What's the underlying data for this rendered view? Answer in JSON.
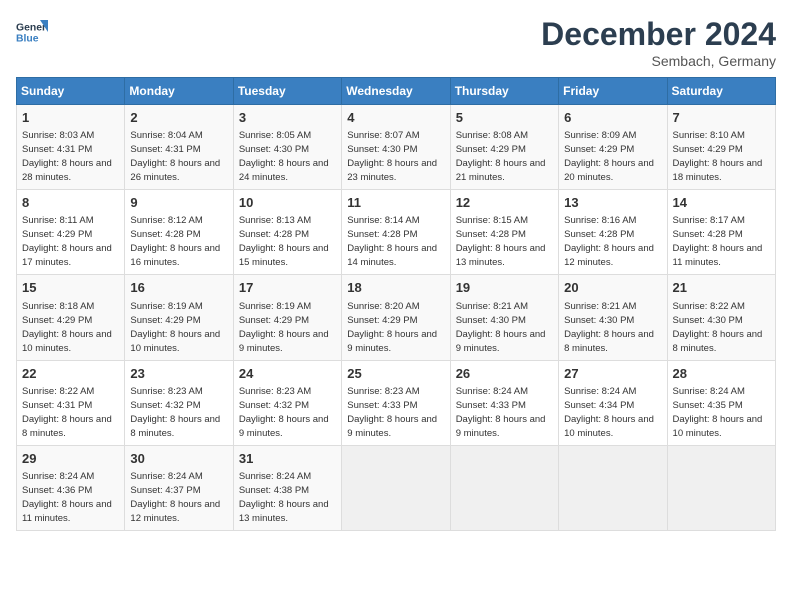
{
  "app": {
    "name": "GeneralBlue",
    "logo_icon": "flag-icon"
  },
  "title": "December 2024",
  "location": "Sembach, Germany",
  "days_of_week": [
    "Sunday",
    "Monday",
    "Tuesday",
    "Wednesday",
    "Thursday",
    "Friday",
    "Saturday"
  ],
  "weeks": [
    [
      {
        "day": "1",
        "sunrise": "8:03 AM",
        "sunset": "4:31 PM",
        "daylight": "8 hours and 28 minutes."
      },
      {
        "day": "2",
        "sunrise": "8:04 AM",
        "sunset": "4:31 PM",
        "daylight": "8 hours and 26 minutes."
      },
      {
        "day": "3",
        "sunrise": "8:05 AM",
        "sunset": "4:30 PM",
        "daylight": "8 hours and 24 minutes."
      },
      {
        "day": "4",
        "sunrise": "8:07 AM",
        "sunset": "4:30 PM",
        "daylight": "8 hours and 23 minutes."
      },
      {
        "day": "5",
        "sunrise": "8:08 AM",
        "sunset": "4:29 PM",
        "daylight": "8 hours and 21 minutes."
      },
      {
        "day": "6",
        "sunrise": "8:09 AM",
        "sunset": "4:29 PM",
        "daylight": "8 hours and 20 minutes."
      },
      {
        "day": "7",
        "sunrise": "8:10 AM",
        "sunset": "4:29 PM",
        "daylight": "8 hours and 18 minutes."
      }
    ],
    [
      {
        "day": "8",
        "sunrise": "8:11 AM",
        "sunset": "4:29 PM",
        "daylight": "8 hours and 17 minutes."
      },
      {
        "day": "9",
        "sunrise": "8:12 AM",
        "sunset": "4:28 PM",
        "daylight": "8 hours and 16 minutes."
      },
      {
        "day": "10",
        "sunrise": "8:13 AM",
        "sunset": "4:28 PM",
        "daylight": "8 hours and 15 minutes."
      },
      {
        "day": "11",
        "sunrise": "8:14 AM",
        "sunset": "4:28 PM",
        "daylight": "8 hours and 14 minutes."
      },
      {
        "day": "12",
        "sunrise": "8:15 AM",
        "sunset": "4:28 PM",
        "daylight": "8 hours and 13 minutes."
      },
      {
        "day": "13",
        "sunrise": "8:16 AM",
        "sunset": "4:28 PM",
        "daylight": "8 hours and 12 minutes."
      },
      {
        "day": "14",
        "sunrise": "8:17 AM",
        "sunset": "4:28 PM",
        "daylight": "8 hours and 11 minutes."
      }
    ],
    [
      {
        "day": "15",
        "sunrise": "8:18 AM",
        "sunset": "4:29 PM",
        "daylight": "8 hours and 10 minutes."
      },
      {
        "day": "16",
        "sunrise": "8:19 AM",
        "sunset": "4:29 PM",
        "daylight": "8 hours and 10 minutes."
      },
      {
        "day": "17",
        "sunrise": "8:19 AM",
        "sunset": "4:29 PM",
        "daylight": "8 hours and 9 minutes."
      },
      {
        "day": "18",
        "sunrise": "8:20 AM",
        "sunset": "4:29 PM",
        "daylight": "8 hours and 9 minutes."
      },
      {
        "day": "19",
        "sunrise": "8:21 AM",
        "sunset": "4:30 PM",
        "daylight": "8 hours and 9 minutes."
      },
      {
        "day": "20",
        "sunrise": "8:21 AM",
        "sunset": "4:30 PM",
        "daylight": "8 hours and 8 minutes."
      },
      {
        "day": "21",
        "sunrise": "8:22 AM",
        "sunset": "4:30 PM",
        "daylight": "8 hours and 8 minutes."
      }
    ],
    [
      {
        "day": "22",
        "sunrise": "8:22 AM",
        "sunset": "4:31 PM",
        "daylight": "8 hours and 8 minutes."
      },
      {
        "day": "23",
        "sunrise": "8:23 AM",
        "sunset": "4:32 PM",
        "daylight": "8 hours and 8 minutes."
      },
      {
        "day": "24",
        "sunrise": "8:23 AM",
        "sunset": "4:32 PM",
        "daylight": "8 hours and 9 minutes."
      },
      {
        "day": "25",
        "sunrise": "8:23 AM",
        "sunset": "4:33 PM",
        "daylight": "8 hours and 9 minutes."
      },
      {
        "day": "26",
        "sunrise": "8:24 AM",
        "sunset": "4:33 PM",
        "daylight": "8 hours and 9 minutes."
      },
      {
        "day": "27",
        "sunrise": "8:24 AM",
        "sunset": "4:34 PM",
        "daylight": "8 hours and 10 minutes."
      },
      {
        "day": "28",
        "sunrise": "8:24 AM",
        "sunset": "4:35 PM",
        "daylight": "8 hours and 10 minutes."
      }
    ],
    [
      {
        "day": "29",
        "sunrise": "8:24 AM",
        "sunset": "4:36 PM",
        "daylight": "8 hours and 11 minutes."
      },
      {
        "day": "30",
        "sunrise": "8:24 AM",
        "sunset": "4:37 PM",
        "daylight": "8 hours and 12 minutes."
      },
      {
        "day": "31",
        "sunrise": "8:24 AM",
        "sunset": "4:38 PM",
        "daylight": "8 hours and 13 minutes."
      },
      null,
      null,
      null,
      null
    ]
  ],
  "labels": {
    "sunrise": "Sunrise:",
    "sunset": "Sunset:",
    "daylight": "Daylight:"
  }
}
